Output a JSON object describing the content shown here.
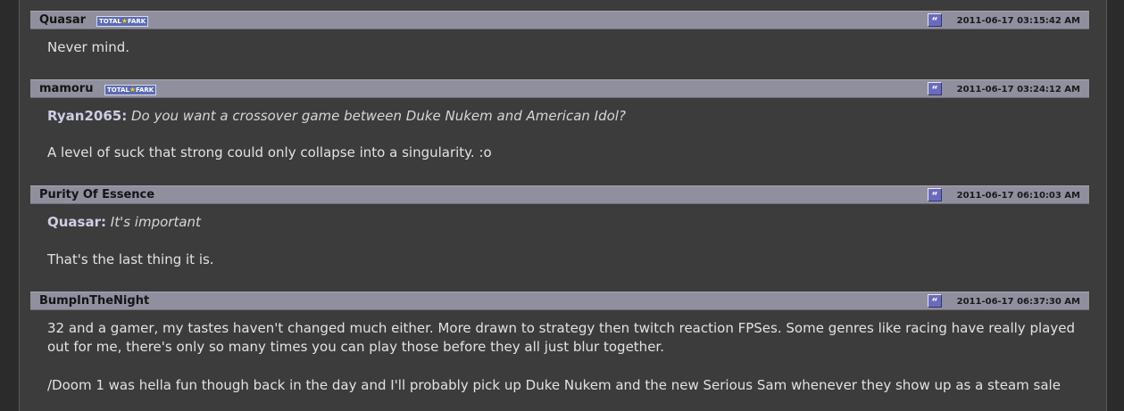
{
  "comments": [
    {
      "username": "Quasar",
      "badge": {
        "left": "TOTAL",
        "right": "FARK"
      },
      "quote_symbol": "“",
      "timestamp": "2011-06-17 03:15:42 AM",
      "quote": null,
      "paragraphs": [
        "Never mind."
      ]
    },
    {
      "username": "mamoru",
      "badge": {
        "left": "TOTAL",
        "right": "FARK"
      },
      "quote_symbol": "“",
      "timestamp": "2011-06-17 03:24:12 AM",
      "quote": {
        "name": "Ryan2065:",
        "text": "Do you want a crossover game between Duke Nukem and American Idol?"
      },
      "paragraphs": [
        "A level of suck that strong could only collapse into a singularity. :o"
      ]
    },
    {
      "username": "Purity Of Essence",
      "badge": null,
      "quote_symbol": "“",
      "timestamp": "2011-06-17 06:10:03 AM",
      "quote": {
        "name": "Quasar:",
        "text": "It's important"
      },
      "paragraphs": [
        "That's the last thing it is."
      ]
    },
    {
      "username": "BumpInTheNight",
      "badge": null,
      "quote_symbol": "“",
      "timestamp": "2011-06-17 06:37:30 AM",
      "quote": null,
      "paragraphs": [
        "32 and a gamer, my tastes haven't changed much either. More drawn to strategy then twitch reaction FPSes. Some genres like racing have really played out for me, there's only so many times you can play those before they all just blur together.",
        "/Doom 1 was hella fun though back in the day and I'll probably pick up Duke Nukem and the new Serious Sam whenever they show up as a steam sale"
      ]
    }
  ]
}
